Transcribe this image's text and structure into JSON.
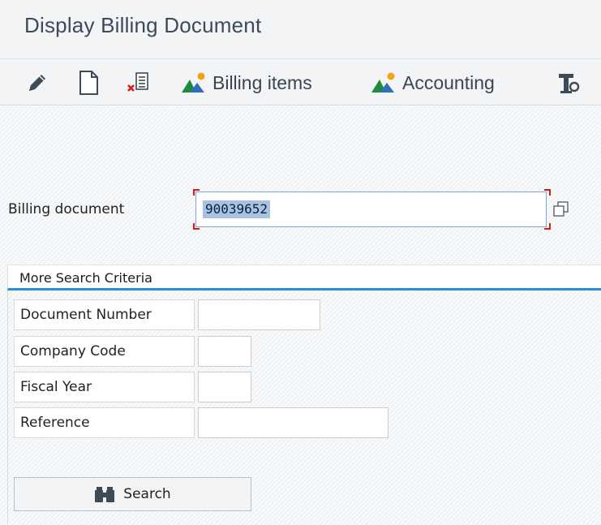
{
  "window": {
    "title": "Display Billing Document"
  },
  "toolbar": {
    "edit_icon": "pencil-icon",
    "create_icon": "document-icon",
    "cancel_icon": "cancel-document-icon",
    "billing_items_label": "Billing items",
    "accounting_label": "Accounting",
    "more_icon": "tools-icon"
  },
  "form": {
    "billing_document_label": "Billing document",
    "billing_document_value": "90039652"
  },
  "search_criteria": {
    "header": "More Search Criteria",
    "fields": [
      {
        "label": "Document Number",
        "value": ""
      },
      {
        "label": "Company Code",
        "value": ""
      },
      {
        "label": "Fiscal Year",
        "value": ""
      },
      {
        "label": "Reference",
        "value": ""
      }
    ],
    "search_label": "Search"
  },
  "colors": {
    "accent": "#2a8fd6",
    "selection": "#a8c3e2",
    "required_bracket": "#d81b1b"
  }
}
